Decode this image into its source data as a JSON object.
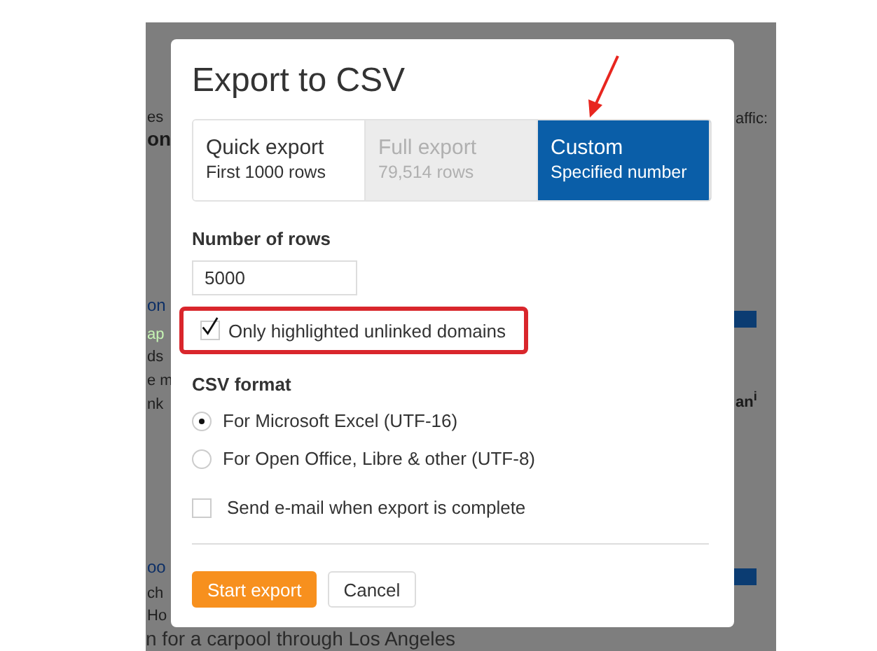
{
  "background_page": {
    "left_fragments": [
      {
        "text": "es",
        "kind": "text"
      },
      {
        "text": "on",
        "kind": "heading"
      },
      {
        "text": "on",
        "kind": "link"
      },
      {
        "text": "ap",
        "kind": "green"
      },
      {
        "text": "ds",
        "kind": "text"
      },
      {
        "text": "e m",
        "kind": "text"
      },
      {
        "text": "nk",
        "kind": "text"
      },
      {
        "text": "oo",
        "kind": "link"
      },
      {
        "text": "ch",
        "kind": "text"
      },
      {
        "text": "Ho",
        "kind": "text"
      }
    ],
    "right_fragments": [
      {
        "text": "affic:",
        "kind": "text"
      },
      {
        "kind": "bar"
      },
      {
        "text": "an$^{i}$",
        "kind": "bold"
      },
      {
        "kind": "bar"
      }
    ],
    "bottom_line": "n for a carpool through Los Angeles"
  },
  "dialog": {
    "title": "Export to CSV",
    "export_options": [
      {
        "title": "Quick export",
        "subtitle": "First 1000 rows",
        "selected": false,
        "disabled": false
      },
      {
        "title": "Full export",
        "subtitle": "79,514 rows",
        "selected": false,
        "disabled": true
      },
      {
        "title": "Custom",
        "subtitle": "Specified number",
        "selected": true,
        "disabled": false
      }
    ],
    "rows_label": "Number of rows",
    "rows_value": "5000",
    "only_highlighted": {
      "label": "Only highlighted unlinked domains",
      "checked": true,
      "highlighted": true
    },
    "format_label": "CSV format",
    "formats": [
      {
        "label": "For Microsoft Excel (UTF-16)",
        "selected": true
      },
      {
        "label": "For Open Office, Libre & other (UTF-8)",
        "selected": false
      }
    ],
    "email": {
      "label": "Send e-mail when export is complete",
      "checked": false
    },
    "buttons": [
      {
        "label": "Start export",
        "kind": "primary"
      },
      {
        "label": "Cancel",
        "kind": "secondary"
      }
    ]
  },
  "annotation_arrow": true
}
